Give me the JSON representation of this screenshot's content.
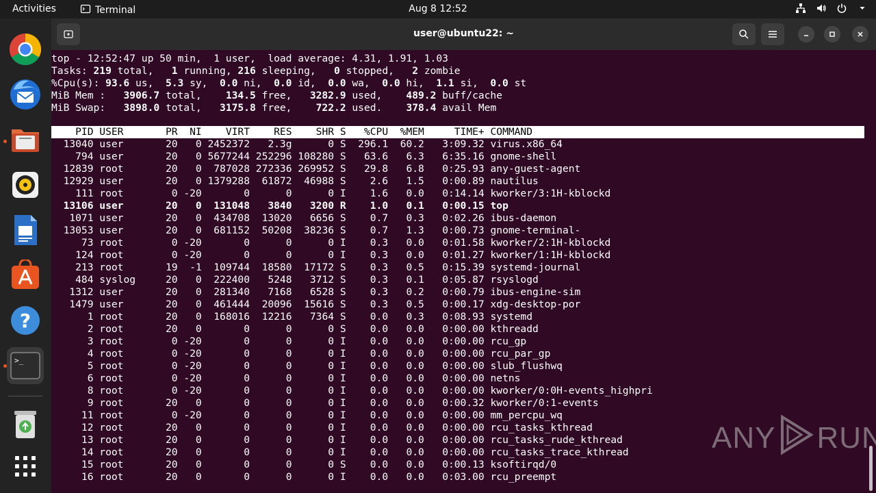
{
  "topbar": {
    "activities": "Activities",
    "app_name": "Terminal",
    "clock": "Aug 8  12:52"
  },
  "dock": {
    "items": [
      "chrome-icon",
      "thunderbird-icon",
      "files-icon",
      "rhythmbox-icon",
      "libreoffice-writer-icon",
      "app-center-icon",
      "help-icon",
      "terminal-icon",
      "trash-icon",
      "show-apps-icon"
    ]
  },
  "window": {
    "title": "user@ubuntu22: ~"
  },
  "top": {
    "summary": {
      "line1": "top - 12:52:47 up 50 min,  1 user,  load average: 4.31, 1.91, 1.03",
      "tasks": {
        "label": "Tasks: ",
        "total": "219",
        "total_l": " total,   ",
        "running": "1",
        "running_l": " running, ",
        "sleeping": "216",
        "sleeping_l": " sleeping,   ",
        "stopped": "0",
        "stopped_l": " stopped,   ",
        "zombie": "2",
        "zombie_l": " zombie"
      },
      "cpu": {
        "label": "%Cpu(s): ",
        "us": "93.6",
        "us_l": " us,  ",
        "sy": "5.3",
        "sy_l": " sy,  ",
        "ni": "0.0",
        "ni_l": " ni,  ",
        "id": "0.0",
        "id_l": " id,  ",
        "wa": "0.0",
        "wa_l": " wa,  ",
        "hi": "0.0",
        "hi_l": " hi,  ",
        "si": "1.1",
        "si_l": " si,  ",
        "st": "0.0",
        "st_l": " st"
      },
      "mem": {
        "label": "MiB Mem :   ",
        "total": "3906.7",
        "total_l": " total,    ",
        "free": "134.5",
        "free_l": " free,   ",
        "used": "3282.9",
        "used_l": " used,    ",
        "buff": "489.2",
        "buff_l": " buff/cache"
      },
      "swap": {
        "label": "MiB Swap:   ",
        "total": "3898.0",
        "total_l": " total,   ",
        "free": "3175.8",
        "free_l": " free,    ",
        "used": "722.2",
        "used_l": " used.    ",
        "avail": "378.4",
        "avail_l": " avail Mem"
      }
    },
    "columns": [
      "PID",
      "USER",
      "PR",
      "NI",
      "VIRT",
      "RES",
      "SHR",
      "S",
      "%CPU",
      "%MEM",
      "TIME+",
      "COMMAND"
    ],
    "processes": [
      {
        "pid": "13040",
        "user": "user",
        "pr": "20",
        "ni": "0",
        "virt": "2452372",
        "res": "2.3g",
        "shr": "0",
        "s": "S",
        "cpu": "296.1",
        "mem": "60.2",
        "time": "3:09.32",
        "cmd": "virus.x86_64"
      },
      {
        "pid": "794",
        "user": "user",
        "pr": "20",
        "ni": "0",
        "virt": "5677244",
        "res": "252296",
        "shr": "108280",
        "s": "S",
        "cpu": "63.6",
        "mem": "6.3",
        "time": "6:35.16",
        "cmd": "gnome-shell"
      },
      {
        "pid": "12839",
        "user": "root",
        "pr": "20",
        "ni": "0",
        "virt": "787028",
        "res": "272336",
        "shr": "269952",
        "s": "S",
        "cpu": "29.8",
        "mem": "6.8",
        "time": "0:25.93",
        "cmd": "any-guest-agent"
      },
      {
        "pid": "12929",
        "user": "user",
        "pr": "20",
        "ni": "0",
        "virt": "1379288",
        "res": "61872",
        "shr": "46988",
        "s": "S",
        "cpu": "2.6",
        "mem": "1.5",
        "time": "0:00.89",
        "cmd": "nautilus"
      },
      {
        "pid": "111",
        "user": "root",
        "pr": "0",
        "ni": "-20",
        "virt": "0",
        "res": "0",
        "shr": "0",
        "s": "I",
        "cpu": "1.6",
        "mem": "0.0",
        "time": "0:14.14",
        "cmd": "kworker/3:1H-kblockd"
      },
      {
        "pid": "13106",
        "user": "user",
        "pr": "20",
        "ni": "0",
        "virt": "131048",
        "res": "3840",
        "shr": "3200",
        "s": "R",
        "cpu": "1.0",
        "mem": "0.1",
        "time": "0:00.15",
        "cmd": "top",
        "bold": true
      },
      {
        "pid": "1071",
        "user": "user",
        "pr": "20",
        "ni": "0",
        "virt": "434708",
        "res": "13020",
        "shr": "6656",
        "s": "S",
        "cpu": "0.7",
        "mem": "0.3",
        "time": "0:02.26",
        "cmd": "ibus-daemon"
      },
      {
        "pid": "13053",
        "user": "user",
        "pr": "20",
        "ni": "0",
        "virt": "681152",
        "res": "50208",
        "shr": "38236",
        "s": "S",
        "cpu": "0.7",
        "mem": "1.3",
        "time": "0:00.73",
        "cmd": "gnome-terminal-"
      },
      {
        "pid": "73",
        "user": "root",
        "pr": "0",
        "ni": "-20",
        "virt": "0",
        "res": "0",
        "shr": "0",
        "s": "I",
        "cpu": "0.3",
        "mem": "0.0",
        "time": "0:01.58",
        "cmd": "kworker/2:1H-kblockd"
      },
      {
        "pid": "124",
        "user": "root",
        "pr": "0",
        "ni": "-20",
        "virt": "0",
        "res": "0",
        "shr": "0",
        "s": "I",
        "cpu": "0.3",
        "mem": "0.0",
        "time": "0:01.27",
        "cmd": "kworker/1:1H-kblockd"
      },
      {
        "pid": "213",
        "user": "root",
        "pr": "19",
        "ni": "-1",
        "virt": "109744",
        "res": "18580",
        "shr": "17172",
        "s": "S",
        "cpu": "0.3",
        "mem": "0.5",
        "time": "0:15.39",
        "cmd": "systemd-journal"
      },
      {
        "pid": "484",
        "user": "syslog",
        "pr": "20",
        "ni": "0",
        "virt": "222400",
        "res": "5248",
        "shr": "3712",
        "s": "S",
        "cpu": "0.3",
        "mem": "0.1",
        "time": "0:05.87",
        "cmd": "rsyslogd"
      },
      {
        "pid": "1312",
        "user": "user",
        "pr": "20",
        "ni": "0",
        "virt": "281340",
        "res": "7168",
        "shr": "6528",
        "s": "S",
        "cpu": "0.3",
        "mem": "0.2",
        "time": "0:00.79",
        "cmd": "ibus-engine-sim"
      },
      {
        "pid": "1479",
        "user": "user",
        "pr": "20",
        "ni": "0",
        "virt": "461444",
        "res": "20096",
        "shr": "15616",
        "s": "S",
        "cpu": "0.3",
        "mem": "0.5",
        "time": "0:00.17",
        "cmd": "xdg-desktop-por"
      },
      {
        "pid": "1",
        "user": "root",
        "pr": "20",
        "ni": "0",
        "virt": "168016",
        "res": "12216",
        "shr": "7364",
        "s": "S",
        "cpu": "0.0",
        "mem": "0.3",
        "time": "0:08.93",
        "cmd": "systemd"
      },
      {
        "pid": "2",
        "user": "root",
        "pr": "20",
        "ni": "0",
        "virt": "0",
        "res": "0",
        "shr": "0",
        "s": "S",
        "cpu": "0.0",
        "mem": "0.0",
        "time": "0:00.00",
        "cmd": "kthreadd"
      },
      {
        "pid": "3",
        "user": "root",
        "pr": "0",
        "ni": "-20",
        "virt": "0",
        "res": "0",
        "shr": "0",
        "s": "I",
        "cpu": "0.0",
        "mem": "0.0",
        "time": "0:00.00",
        "cmd": "rcu_gp"
      },
      {
        "pid": "4",
        "user": "root",
        "pr": "0",
        "ni": "-20",
        "virt": "0",
        "res": "0",
        "shr": "0",
        "s": "I",
        "cpu": "0.0",
        "mem": "0.0",
        "time": "0:00.00",
        "cmd": "rcu_par_gp"
      },
      {
        "pid": "5",
        "user": "root",
        "pr": "0",
        "ni": "-20",
        "virt": "0",
        "res": "0",
        "shr": "0",
        "s": "I",
        "cpu": "0.0",
        "mem": "0.0",
        "time": "0:00.00",
        "cmd": "slub_flushwq"
      },
      {
        "pid": "6",
        "user": "root",
        "pr": "0",
        "ni": "-20",
        "virt": "0",
        "res": "0",
        "shr": "0",
        "s": "I",
        "cpu": "0.0",
        "mem": "0.0",
        "time": "0:00.00",
        "cmd": "netns"
      },
      {
        "pid": "8",
        "user": "root",
        "pr": "0",
        "ni": "-20",
        "virt": "0",
        "res": "0",
        "shr": "0",
        "s": "I",
        "cpu": "0.0",
        "mem": "0.0",
        "time": "0:00.00",
        "cmd": "kworker/0:0H-events_highpri"
      },
      {
        "pid": "9",
        "user": "root",
        "pr": "20",
        "ni": "0",
        "virt": "0",
        "res": "0",
        "shr": "0",
        "s": "I",
        "cpu": "0.0",
        "mem": "0.0",
        "time": "0:00.32",
        "cmd": "kworker/0:1-events"
      },
      {
        "pid": "11",
        "user": "root",
        "pr": "0",
        "ni": "-20",
        "virt": "0",
        "res": "0",
        "shr": "0",
        "s": "I",
        "cpu": "0.0",
        "mem": "0.0",
        "time": "0:00.00",
        "cmd": "mm_percpu_wq"
      },
      {
        "pid": "12",
        "user": "root",
        "pr": "20",
        "ni": "0",
        "virt": "0",
        "res": "0",
        "shr": "0",
        "s": "I",
        "cpu": "0.0",
        "mem": "0.0",
        "time": "0:00.00",
        "cmd": "rcu_tasks_kthread"
      },
      {
        "pid": "13",
        "user": "root",
        "pr": "20",
        "ni": "0",
        "virt": "0",
        "res": "0",
        "shr": "0",
        "s": "I",
        "cpu": "0.0",
        "mem": "0.0",
        "time": "0:00.00",
        "cmd": "rcu_tasks_rude_kthread"
      },
      {
        "pid": "14",
        "user": "root",
        "pr": "20",
        "ni": "0",
        "virt": "0",
        "res": "0",
        "shr": "0",
        "s": "I",
        "cpu": "0.0",
        "mem": "0.0",
        "time": "0:00.00",
        "cmd": "rcu_tasks_trace_kthread"
      },
      {
        "pid": "15",
        "user": "root",
        "pr": "20",
        "ni": "0",
        "virt": "0",
        "res": "0",
        "shr": "0",
        "s": "S",
        "cpu": "0.0",
        "mem": "0.0",
        "time": "0:00.13",
        "cmd": "ksoftirqd/0"
      },
      {
        "pid": "16",
        "user": "root",
        "pr": "20",
        "ni": "0",
        "virt": "0",
        "res": "0",
        "shr": "0",
        "s": "I",
        "cpu": "0.0",
        "mem": "0.0",
        "time": "0:03.00",
        "cmd": "rcu_preempt"
      }
    ]
  },
  "watermark": {
    "left": "ANY",
    "right": "RUN"
  },
  "colors": {
    "terminal_bg": "#300a24",
    "accent": "#e95420"
  }
}
